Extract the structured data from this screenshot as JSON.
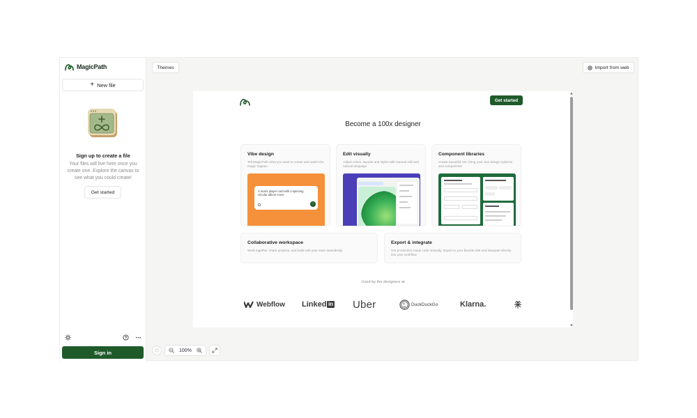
{
  "sidebar": {
    "brand": "MagicPath",
    "new_file_label": "New file",
    "signup_title": "Sign up to create a file",
    "signup_description": "Your files will live here once you create one. Explore the canvas to see what you could create!",
    "get_started_label": "Get started",
    "sign_in_label": "Sign in",
    "footer_icons": [
      "sun-icon",
      "help-icon",
      "more-icon"
    ]
  },
  "toolbar": {
    "themes_label": "Themes",
    "import_label": "Import from web"
  },
  "canvas": {
    "get_started_label": "Get started",
    "hero_title": "Become a 100x designer",
    "cards": [
      {
        "title": "Vibe design",
        "description": "Tell MagicPath what you want to create and watch the magic happen.",
        "preview_prompt": "A music player card with a spinning circular album cover"
      },
      {
        "title": "Edit visually",
        "description": "Adjust colors, layouts and styles with manual edit and natural language"
      },
      {
        "title": "Component libraries",
        "description": "Create beautiful UIs, bring your own design systems and components"
      },
      {
        "title": "Collaborative workspace",
        "description": "Work together, share projects, and build with your team seamlessly"
      },
      {
        "title": "Export & integrate",
        "description": "Get production-ready code instantly. Export to your favorite IDE and integrate directly into your workflow"
      }
    ],
    "used_by_label": "Used by the designers at",
    "brands": [
      "Webflow",
      "Linked",
      "in",
      "Uber",
      "DuckDuckGo",
      "Klarna."
    ]
  },
  "zoom": {
    "level": "100%"
  },
  "colors": {
    "primary_green": "#1f5a2b",
    "vibe_orange": "#f5913a",
    "edit_blue": "#4a3fb8",
    "library_green": "#1e6b3c"
  }
}
